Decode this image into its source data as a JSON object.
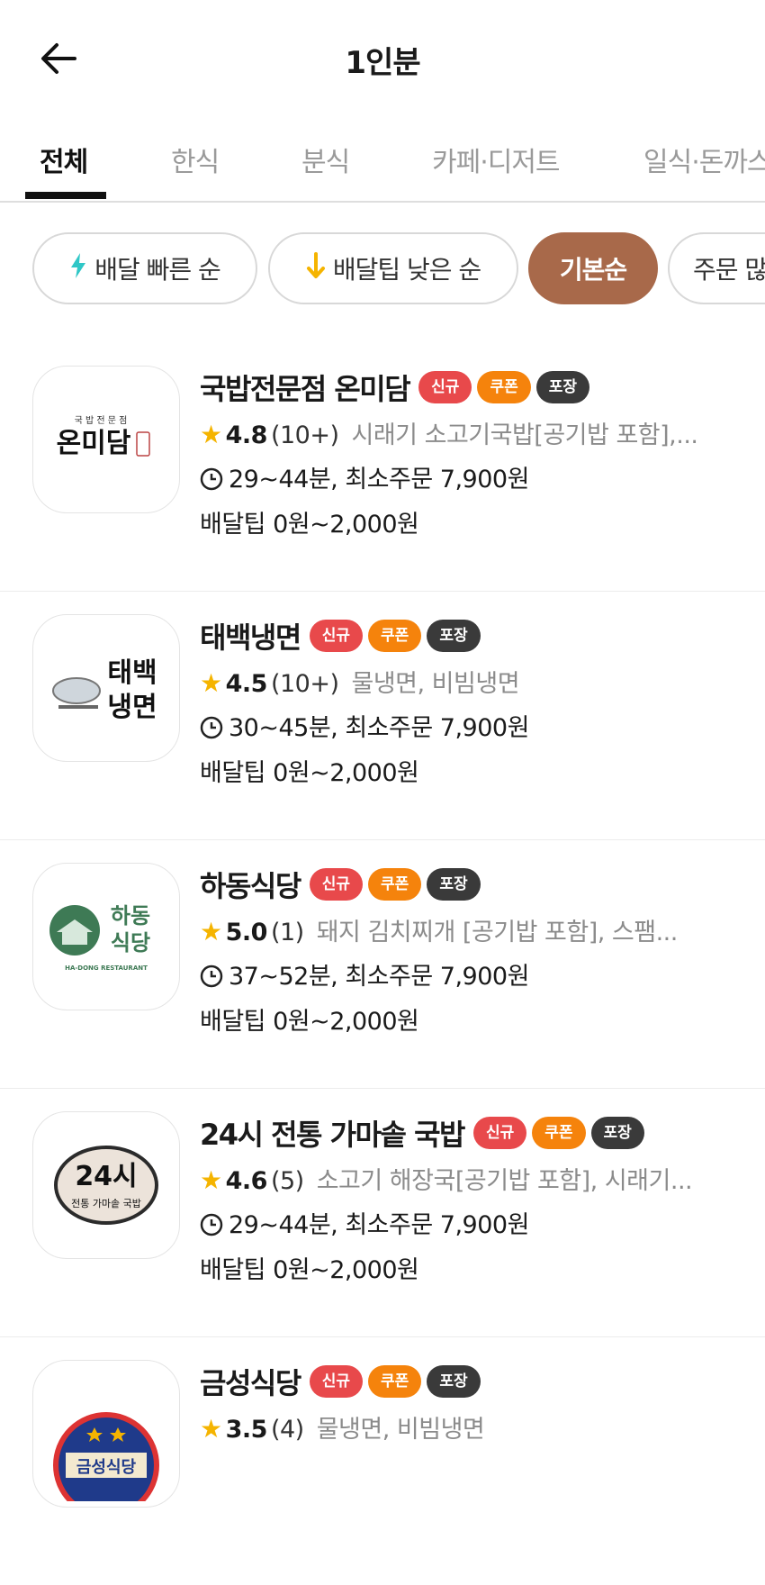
{
  "header": {
    "title": "1인분"
  },
  "tabs": [
    "전체",
    "한식",
    "분식",
    "카페·디저트",
    "일식·돈까스"
  ],
  "sort_chips": [
    {
      "label": "배달 빠른 순",
      "icon": "lightning-icon"
    },
    {
      "label": "배달팁 낮은 순",
      "icon": "arrow-down-icon"
    },
    {
      "label": "기본순",
      "icon": ""
    },
    {
      "label": "주문 많은 순",
      "icon": ""
    }
  ],
  "colors": {
    "accent": "#a8694a",
    "new": "#e8494b",
    "coupon": "#f5830c",
    "pack": "#3a3a3a",
    "star": "#f5b400"
  },
  "badges": {
    "new": "신규",
    "coupon": "쿠폰",
    "pack": "포장"
  },
  "restaurants": [
    {
      "name": "국밥전문점 온미담",
      "logo_top": "국 밥 전 문 점",
      "logo_main": "온미담",
      "rating": "4.8",
      "reviews": "(10+)",
      "menu": "시래기 소고기국밥[공기밥 포함],...",
      "time": "29~44분,  최소주문 7,900원",
      "tip": "배달팁 0원~2,000원"
    },
    {
      "name": "태백냉면",
      "logo_top": "태백",
      "logo_main": "냉면",
      "rating": "4.5",
      "reviews": "(10+)",
      "menu": "물냉면, 비빔냉면",
      "time": "30~45분,  최소주문 7,900원",
      "tip": "배달팁 0원~2,000원"
    },
    {
      "name": "하동식당",
      "logo_top": "하동",
      "logo_main": "식당",
      "logo_sub": "HA-DONG RESTAURANT",
      "rating": "5.0",
      "reviews": "(1)",
      "menu": "돼지 김치찌개 [공기밥 포함], 스팸...",
      "time": "37~52분,  최소주문 7,900원",
      "tip": "배달팁 0원~2,000원"
    },
    {
      "name": "24시 전통 가마솥 국밥",
      "logo_top": "24시",
      "logo_main": "전통 가마솥 국밥",
      "rating": "4.6",
      "reviews": "(5)",
      "menu": "소고기 해장국[공기밥 포함], 시래기...",
      "time": "29~44분,  최소주문 7,900원",
      "tip": "배달팁 0원~2,000원"
    },
    {
      "name": "금성식당",
      "logo_main": "금성식당",
      "rating": "3.5",
      "reviews": "(4)",
      "menu": "물냉면, 비빔냉면",
      "time": "",
      "tip": ""
    }
  ]
}
